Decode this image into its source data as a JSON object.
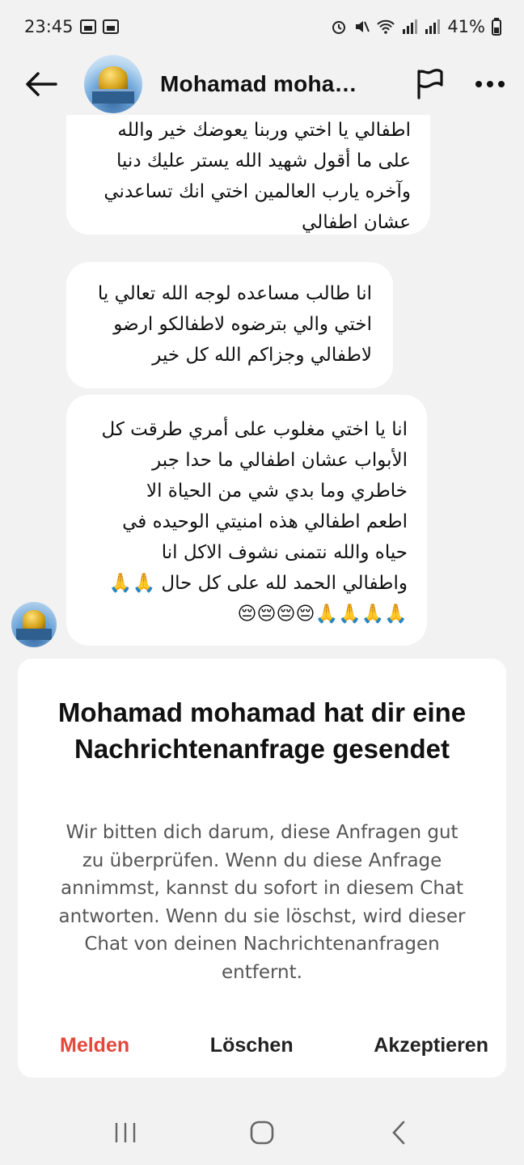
{
  "status_bar": {
    "time": "23:45",
    "battery": "41%"
  },
  "header": {
    "contact_name": "Mohamad moha…",
    "icons": [
      "back-arrow-icon",
      "flag-icon",
      "more-icon"
    ]
  },
  "messages": [
    {
      "text": "اطفالي  يا اختي وربنا يعوضك خير والله\nعلى ما أقول شهيد الله يستر عليك دنيا\nوآخره يارب العالمين اختي انك تساعدني\nعشان اطفالي"
    },
    {
      "text": "انا طالب مساعده لوجه الله تعالي يا\nاختي والي بترضوه لاطفالكو ارضو\nلاطفالي وجزاكم الله كل خير"
    },
    {
      "text": "انا يا اختي مغلوب على أمري طرقت كل\nالأبواب عشان اطفالي ما حدا جبر\nخاطري وما بدي شي من الحياة  الا\nاطعم اطفالي هذه امنيتي الوحيده في\nحياه والله نتمنى نشوف الاكل انا\nواطفالي  الحمد لله على كل حال 🙏🙏\n🙏🙏🙏🙏😔😔😔😔"
    }
  ],
  "request": {
    "title": "Mohamad mohamad hat dir eine Nachrichtenanfrage gesendet",
    "body": "Wir bitten dich darum, diese Anfragen gut zu überprüfen. Wenn du diese Anfrage annimmst, kannst du sofort in diesem Chat antworten. Wenn du sie löschst, wird dieser Chat von deinen Nachrichtenanfragen entfernt.",
    "report_label": "Melden",
    "delete_label": "Löschen",
    "accept_label": "Akzeptieren"
  },
  "colors": {
    "report": "#e5473a",
    "background": "#f2f2f2",
    "bubble": "#ffffff"
  }
}
